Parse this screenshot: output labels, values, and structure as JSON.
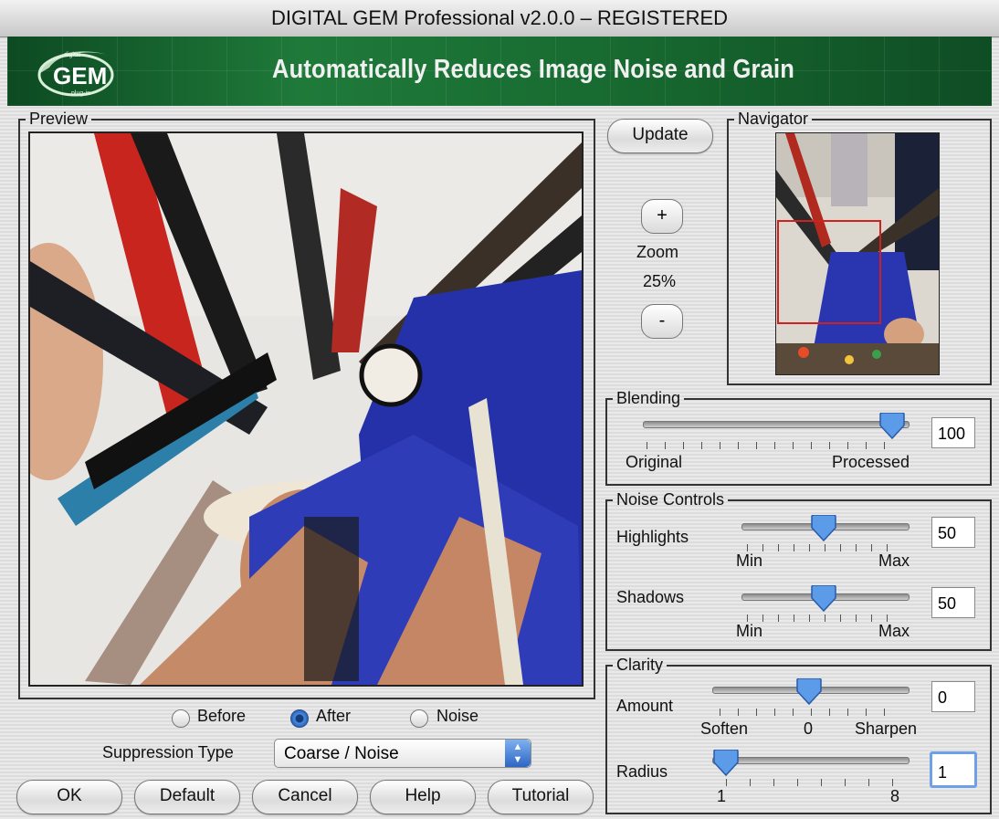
{
  "window": {
    "title": "DIGITAL GEM Professional v2.0.0 – REGISTERED"
  },
  "banner": {
    "tagline": "Automatically Reduces Image Noise and Grain",
    "logo_text": "GEM",
    "logo_small_top": "digital",
    "logo_small_bottom": "plug-in"
  },
  "preview": {
    "legend": "Preview"
  },
  "navigator": {
    "legend": "Navigator"
  },
  "update_label": "Update",
  "zoom": {
    "plus": "+",
    "label": "Zoom",
    "value": "25%",
    "minus": "-"
  },
  "blending": {
    "legend": "Blending",
    "value": "100",
    "min_label": "Original",
    "max_label": "Processed",
    "level": 1.0
  },
  "noise_controls": {
    "legend": "Noise Controls",
    "highlights": {
      "label": "Highlights",
      "value": "50",
      "min": "Min",
      "max": "Max",
      "level": 0.5
    },
    "shadows": {
      "label": "Shadows",
      "value": "50",
      "min": "Min",
      "max": "Max",
      "level": 0.5
    }
  },
  "clarity": {
    "legend": "Clarity",
    "amount": {
      "label": "Amount",
      "value": "0",
      "min": "Soften",
      "mid": "0",
      "max": "Sharpen",
      "level": 0.5
    },
    "radius": {
      "label": "Radius",
      "value": "1",
      "min": "1",
      "max": "8",
      "level": 0.0
    }
  },
  "view_mode": {
    "options": [
      "Before",
      "After",
      "Noise"
    ],
    "selected": "After"
  },
  "suppression": {
    "label": "Suppression Type",
    "value": "Coarse / Noise"
  },
  "buttons": {
    "ok": "OK",
    "default": "Default",
    "cancel": "Cancel",
    "help": "Help",
    "tutorial": "Tutorial"
  },
  "colors": {
    "banner_green": "#1f7a3a",
    "slider_thumb": "#4a8be0",
    "nav_box": "#d22020"
  }
}
